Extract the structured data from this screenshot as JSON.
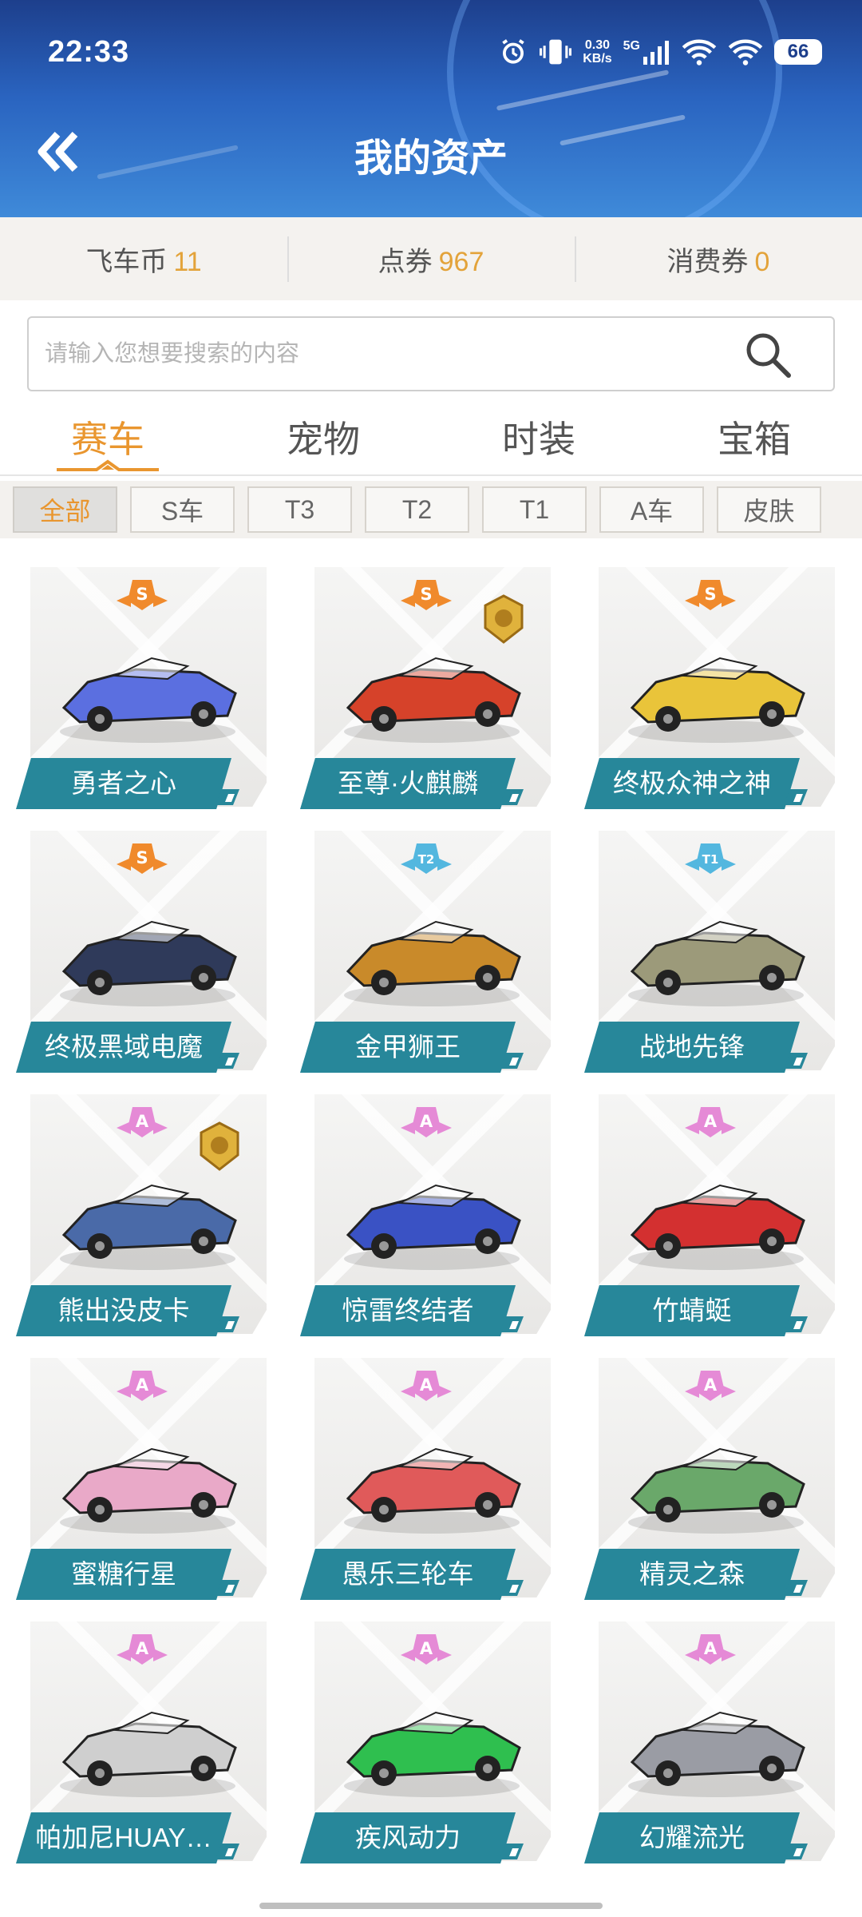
{
  "status_bar": {
    "time": "22:33",
    "speed": "0.30",
    "speed_unit": "KB/s",
    "network": "5G",
    "battery": "66"
  },
  "header": {
    "title": "我的资产"
  },
  "currency": [
    {
      "label": "飞车币",
      "value": "11"
    },
    {
      "label": "点券",
      "value": "967"
    },
    {
      "label": "消费券",
      "value": "0"
    }
  ],
  "search": {
    "placeholder": "请输入您想要搜索的内容"
  },
  "tabs": [
    {
      "label": "赛车",
      "active": true
    },
    {
      "label": "宠物",
      "active": false
    },
    {
      "label": "时装",
      "active": false
    },
    {
      "label": "宝箱",
      "active": false
    }
  ],
  "filters": [
    {
      "label": "全部",
      "active": true
    },
    {
      "label": "S车"
    },
    {
      "label": "T3"
    },
    {
      "label": "T2"
    },
    {
      "label": "T1"
    },
    {
      "label": "A车"
    },
    {
      "label": "皮肤"
    }
  ],
  "items": [
    {
      "name": "勇者之心",
      "grade": "S",
      "color": "#5b6fe0"
    },
    {
      "name": "至尊·火麒麟",
      "grade": "S",
      "color": "#d6422a",
      "medal": true
    },
    {
      "name": "终极众神之神",
      "grade": "S",
      "color": "#e9c43a"
    },
    {
      "name": "终极黑域电魔",
      "grade": "S",
      "color": "#2f3a5a"
    },
    {
      "name": "金甲狮王",
      "grade": "T2",
      "color": "#c98a2a"
    },
    {
      "name": "战地先锋",
      "grade": "T1",
      "color": "#9c9a7a"
    },
    {
      "name": "熊出没皮卡",
      "grade": "A",
      "color": "#4a6aa8",
      "medal": true
    },
    {
      "name": "惊雷终结者",
      "grade": "A",
      "color": "#3a52c4"
    },
    {
      "name": "竹蜻蜓",
      "grade": "A",
      "color": "#d33030"
    },
    {
      "name": "蜜糖行星",
      "grade": "A",
      "color": "#e9a9c8"
    },
    {
      "name": "愚乐三轮车",
      "grade": "A",
      "color": "#e05a5a"
    },
    {
      "name": "精灵之森",
      "grade": "A",
      "color": "#6aa86a"
    },
    {
      "name": "帕加尼HUAY…",
      "grade": "A",
      "color": "#cfcfcf"
    },
    {
      "name": "疾风动力",
      "grade": "A",
      "color": "#2fbf4f"
    },
    {
      "name": "幻耀流光",
      "grade": "A",
      "color": "#9a9ca4"
    }
  ]
}
